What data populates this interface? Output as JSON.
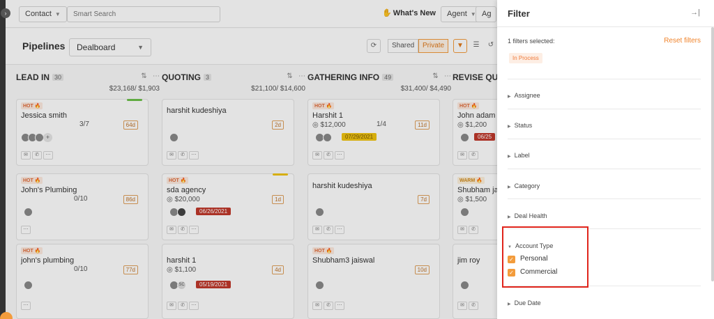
{
  "topbar": {
    "contact_select": "Contact",
    "search_placeholder": "Smart Search",
    "whats_new": "What's New",
    "agent_select": "Agent",
    "agent_select_trunc": "Ag"
  },
  "pipeline": {
    "title": "Pipelines",
    "selected": "Dealboard",
    "shared": "Shared",
    "private": "Private"
  },
  "columns": [
    {
      "name": "LEAD IN",
      "count": "30",
      "amount": "$23,168/ $1,903",
      "cards": [
        {
          "badge": "HOT",
          "name": "Jessica smith",
          "frac": "3/7",
          "days": "64d"
        },
        {
          "badge": "HOT",
          "name": "John's Plumbing",
          "frac": "0/10",
          "days": "86d"
        },
        {
          "badge": "HOT",
          "name": "john's plumbing",
          "frac": "0/10",
          "days": "77d"
        }
      ]
    },
    {
      "name": "QUOTING",
      "count": "3",
      "amount": "$21,100/ $14,600",
      "cards": [
        {
          "badge": "",
          "name": "harshit kudeshiya",
          "days": "2d"
        },
        {
          "badge": "HOT",
          "name": "sda agency",
          "amount": "$20,000",
          "days": "1d",
          "date": "06/26/2021"
        },
        {
          "badge": "",
          "name": "harshit 1",
          "amount": "$1,100",
          "days": "4d",
          "date": "05/19/2021",
          "initials": "SC"
        }
      ]
    },
    {
      "name": "GATHERING INFO",
      "count": "49",
      "amount": "$31,400/ $4,490",
      "cards": [
        {
          "badge": "HOT",
          "name": "Harshit 1",
          "amount": "$12,000",
          "frac": "1/4",
          "days": "11d",
          "date": "07/29/2021"
        },
        {
          "badge": "",
          "name": "harshit kudeshiya",
          "days": "7d"
        },
        {
          "badge": "HOT",
          "name": "Shubham3 jaiswal",
          "days": "10d"
        }
      ]
    },
    {
      "name": "REVISE QUO",
      "cards": [
        {
          "badge": "HOT",
          "name": "John adam",
          "amount": "$1,200",
          "date": "06/25"
        },
        {
          "badge": "WARM",
          "name": "Shubham ja",
          "amount": "$1,500"
        },
        {
          "badge": "",
          "name": "jim roy"
        }
      ]
    }
  ],
  "filter": {
    "title": "Filter",
    "selected_count": "1 filters selected:",
    "reset": "Reset filters",
    "active_tag": "In Process",
    "sections": [
      "Assignee",
      "Status",
      "Label",
      "Category",
      "Deal Health"
    ],
    "account_type": {
      "label": "Account Type",
      "options": [
        {
          "label": "Personal",
          "checked": true
        },
        {
          "label": "Commercial",
          "checked": true
        }
      ]
    },
    "due_date": "Due Date"
  },
  "colors": {
    "accent": "#f39c3c",
    "hot": "#e06b3a",
    "overdue": "#c0392b",
    "highlight": "#e0241b"
  }
}
